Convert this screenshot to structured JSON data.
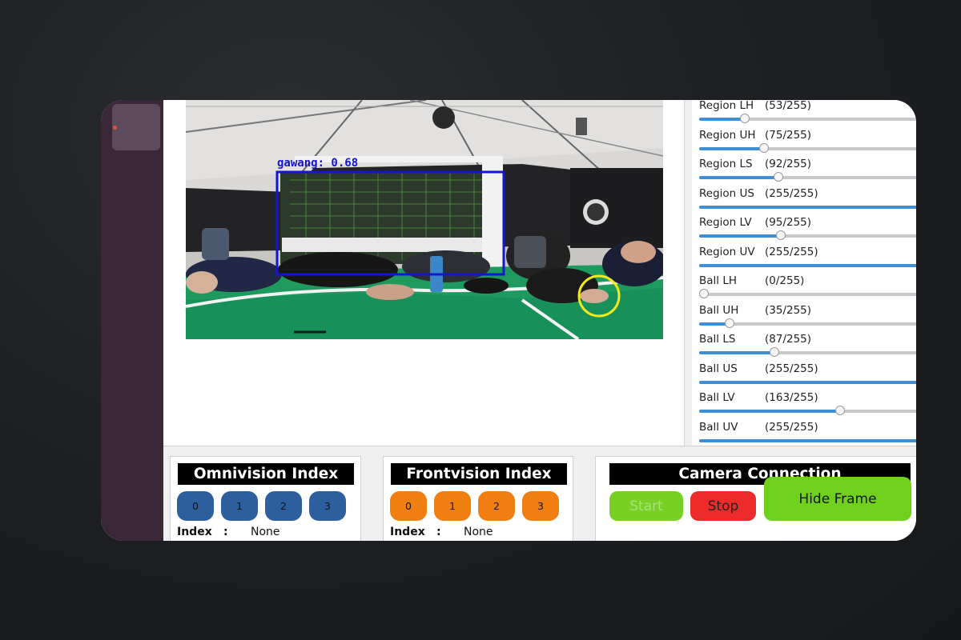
{
  "detection": {
    "label": "gawang: 0.68",
    "box_color": "#1414d2",
    "ball_marker_color": "#f2ea1a"
  },
  "sliders": [
    {
      "name": "Region LH",
      "value": 53,
      "display": "(53/255)"
    },
    {
      "name": "Region UH",
      "value": 75,
      "display": "(75/255)"
    },
    {
      "name": "Region LS",
      "value": 92,
      "display": "(92/255)"
    },
    {
      "name": "Region US",
      "value": 255,
      "display": "(255/255)"
    },
    {
      "name": "Region LV",
      "value": 95,
      "display": "(95/255)"
    },
    {
      "name": "Region UV",
      "value": 255,
      "display": "(255/255)"
    },
    {
      "name": "Ball LH",
      "value": 0,
      "display": "(0/255)"
    },
    {
      "name": "Ball UH",
      "value": 35,
      "display": "(35/255)"
    },
    {
      "name": "Ball LS",
      "value": 87,
      "display": "(87/255)"
    },
    {
      "name": "Ball US",
      "value": 255,
      "display": "(255/255)"
    },
    {
      "name": "Ball LV",
      "value": 163,
      "display": "(163/255)"
    },
    {
      "name": "Ball UV",
      "value": 255,
      "display": "(255/255)"
    }
  ],
  "slider_max": 255,
  "omnivision": {
    "title": "Omnivision Index",
    "buttons": [
      "0",
      "1",
      "2",
      "3"
    ],
    "index_label": "Index",
    "colon": ":",
    "index_value": "None",
    "color": "#2d5f9e"
  },
  "frontvision": {
    "title": "Frontvision Index",
    "buttons": [
      "0",
      "1",
      "2",
      "3"
    ],
    "index_label": "Index",
    "colon": ":",
    "index_value": "None",
    "color": "#f07f12"
  },
  "camera": {
    "title": "Camera Connection",
    "start_label": "Start",
    "stop_label": "Stop",
    "hide_label": "Hide Frame",
    "start_color": "#78d024",
    "stop_color": "#ee2b2b",
    "hide_color": "#6fd11c"
  }
}
